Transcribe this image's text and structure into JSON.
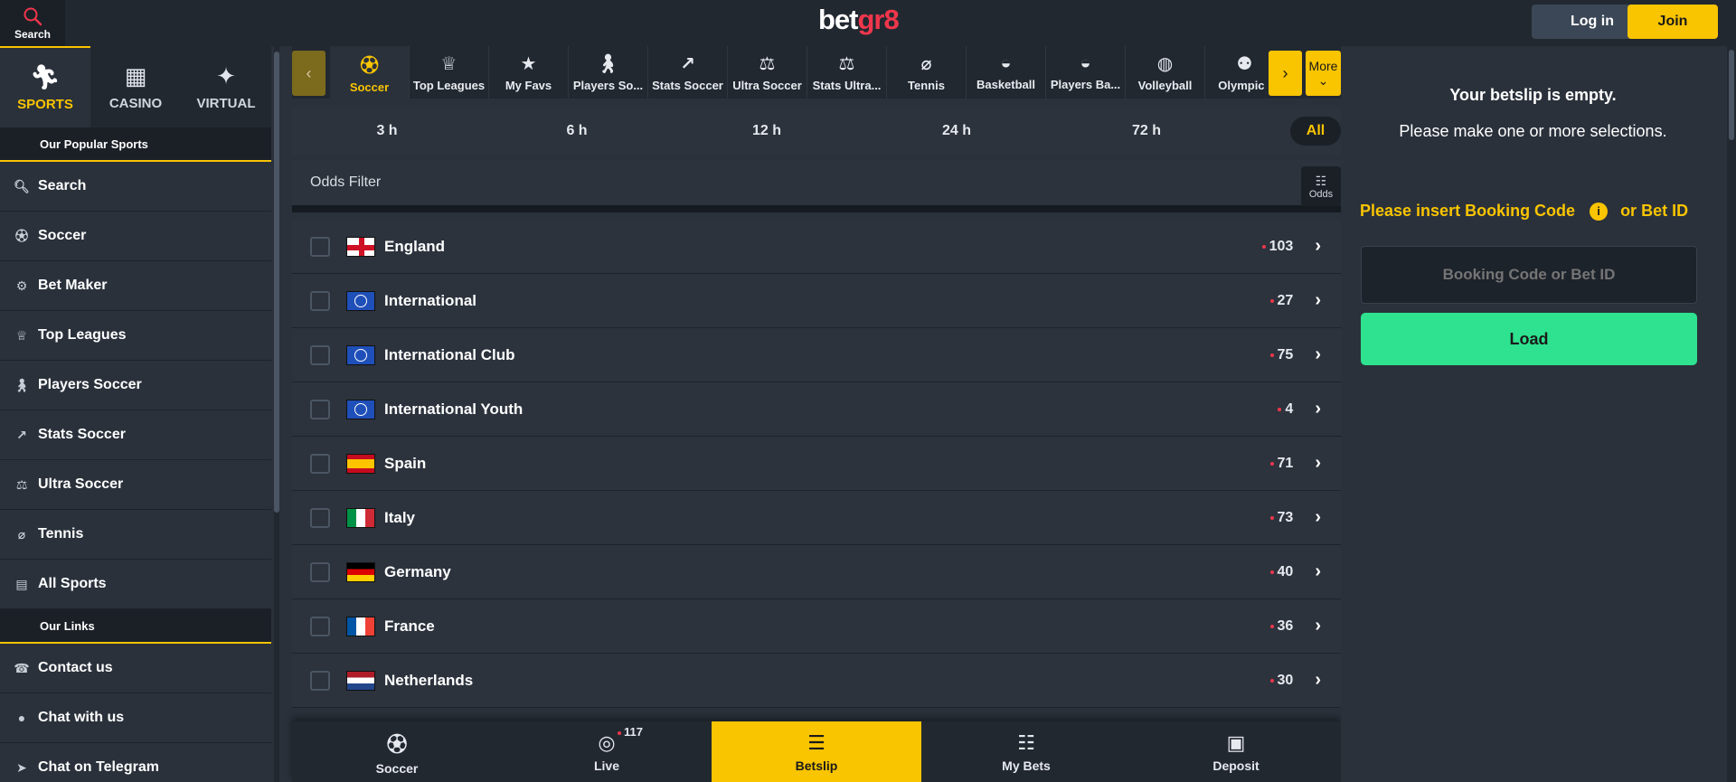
{
  "header": {
    "search_label": "Search",
    "logo_main": "bet",
    "logo_accent": "gr8",
    "login_label": "Log in",
    "join_label": "Join"
  },
  "sidebar": {
    "products": [
      {
        "label": "SPORTS",
        "icon": "runner-icon",
        "active": true
      },
      {
        "label": "CASINO",
        "icon": "slot-machine-icon",
        "active": false
      },
      {
        "label": "VIRTUAL",
        "icon": "virtual-icon",
        "active": false
      }
    ],
    "popular_heading": "Our Popular Sports",
    "items": [
      {
        "label": "Search",
        "icon": "search-icon"
      },
      {
        "label": "Soccer",
        "icon": "soccer-ball-icon"
      },
      {
        "label": "Bet Maker",
        "icon": "bet-maker-icon"
      },
      {
        "label": "Top Leagues",
        "icon": "trophy-icon"
      },
      {
        "label": "Players Soccer",
        "icon": "player-icon"
      },
      {
        "label": "Stats Soccer",
        "icon": "chart-icon"
      },
      {
        "label": "Ultra Soccer",
        "icon": "ultra-icon"
      },
      {
        "label": "Tennis",
        "icon": "tennis-racket-icon"
      },
      {
        "label": "All Sports",
        "icon": "stadium-icon"
      }
    ],
    "links_heading": "Our Links",
    "links": [
      {
        "label": "Contact us",
        "icon": "headset-icon"
      },
      {
        "label": "Chat with us",
        "icon": "chat-icon"
      },
      {
        "label": "Chat on Telegram",
        "icon": "telegram-icon"
      }
    ]
  },
  "sport_strip": {
    "items": [
      {
        "label": "Soccer",
        "active": true
      },
      {
        "label": "Top Leagues",
        "active": false
      },
      {
        "label": "My Favs",
        "active": false
      },
      {
        "label": "Players So...",
        "active": false
      },
      {
        "label": "Stats Soccer",
        "active": false
      },
      {
        "label": "Ultra Soccer",
        "active": false
      },
      {
        "label": "Stats Ultra...",
        "active": false
      },
      {
        "label": "Tennis",
        "active": false
      },
      {
        "label": "Basketball",
        "active": false
      },
      {
        "label": "Players Ba...",
        "active": false
      },
      {
        "label": "Volleyball",
        "active": false
      },
      {
        "label": "Olympics",
        "active": false
      }
    ],
    "more_label": "More"
  },
  "time_filters": {
    "items": [
      "3 h",
      "6 h",
      "12 h",
      "24 h",
      "72 h"
    ],
    "all_label": "All"
  },
  "odds_filter": {
    "label": "Odds Filter",
    "button_label": "Odds"
  },
  "countries": [
    {
      "name": "England",
      "count": "103",
      "flag": "england"
    },
    {
      "name": "International",
      "count": "27",
      "flag": "globe"
    },
    {
      "name": "International Club",
      "count": "75",
      "flag": "globe"
    },
    {
      "name": "International Youth",
      "count": "4",
      "flag": "globe"
    },
    {
      "name": "Spain",
      "count": "71",
      "flag": "spain"
    },
    {
      "name": "Italy",
      "count": "73",
      "flag": "italy"
    },
    {
      "name": "Germany",
      "count": "40",
      "flag": "germany"
    },
    {
      "name": "France",
      "count": "36",
      "flag": "france"
    },
    {
      "name": "Netherlands",
      "count": "30",
      "flag": "netherlands"
    }
  ],
  "bottom_nav": {
    "items": [
      {
        "label": "Soccer",
        "icon": "soccer-ball-icon"
      },
      {
        "label": "Live",
        "icon": "live-icon",
        "badge": "117"
      },
      {
        "label": "Betslip",
        "icon": "betslip-icon",
        "active": true
      },
      {
        "label": "My Bets",
        "icon": "my-bets-icon"
      },
      {
        "label": "Deposit",
        "icon": "wallet-icon"
      }
    ]
  },
  "betslip": {
    "empty_title": "Your betslip is empty.",
    "empty_sub": "Please make one or more selections.",
    "booking_prefix": "Please insert Booking Code",
    "booking_suffix": "or Bet ID",
    "input_placeholder": "Booking Code or Bet ID",
    "load_label": "Load"
  },
  "colors": {
    "accent": "#f9c400",
    "brand_red": "#f0364c",
    "load_green": "#2ee28f",
    "background": "#2a313b"
  }
}
